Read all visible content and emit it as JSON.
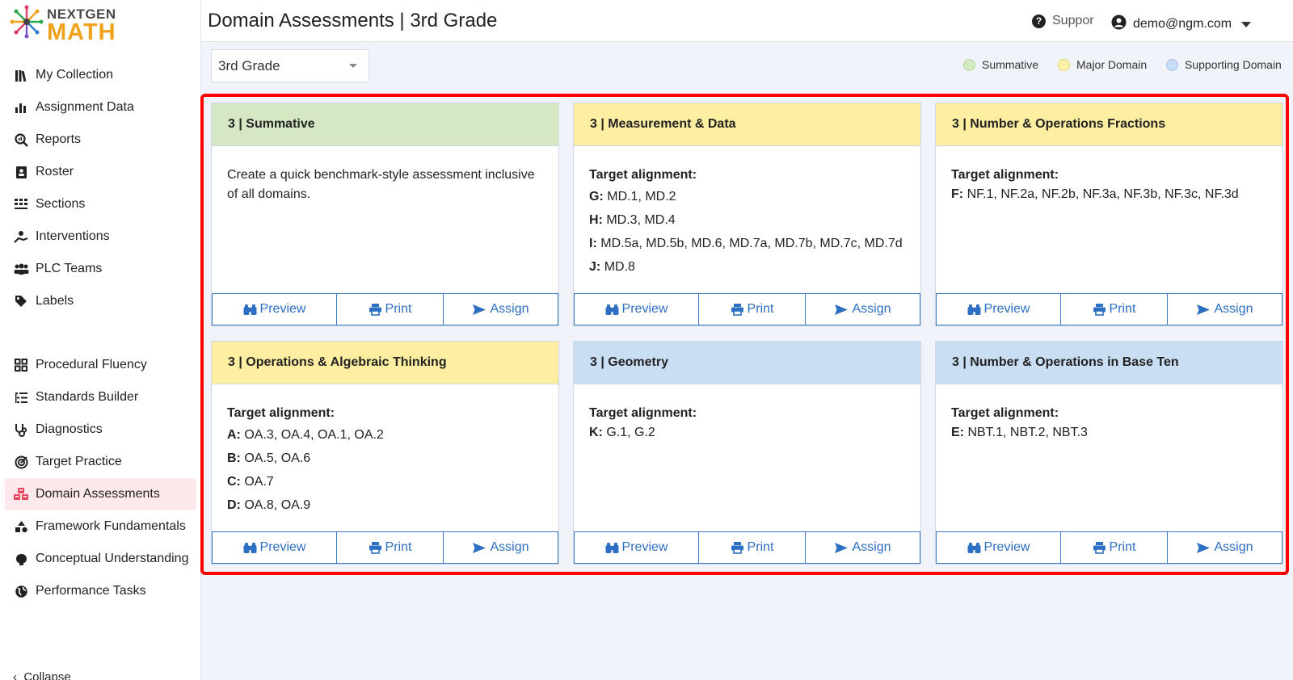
{
  "brand": {
    "top": "NEXTGEN",
    "bottom": "MATH"
  },
  "header": {
    "title": "Domain Assessments | 3rd Grade",
    "support_label": "Suppor",
    "user_email": "demo@ngm.com"
  },
  "sidebar": {
    "group1": [
      {
        "label": "My Collection",
        "icon": "library-icon"
      },
      {
        "label": "Assignment Data",
        "icon": "bar-chart-icon"
      },
      {
        "label": "Reports",
        "icon": "search-chart-icon"
      },
      {
        "label": "Roster",
        "icon": "id-card-icon"
      },
      {
        "label": "Sections",
        "icon": "seating-icon"
      },
      {
        "label": "Interventions",
        "icon": "helping-hand-icon"
      },
      {
        "label": "PLC Teams",
        "icon": "users-icon"
      },
      {
        "label": "Labels",
        "icon": "tag-icon"
      }
    ],
    "group2": [
      {
        "label": "Procedural Fluency",
        "icon": "grid-icon"
      },
      {
        "label": "Standards Builder",
        "icon": "list-check-icon"
      },
      {
        "label": "Diagnostics",
        "icon": "stethoscope-icon"
      },
      {
        "label": "Target Practice",
        "icon": "target-icon"
      },
      {
        "label": "Domain Assessments",
        "icon": "cubes-icon",
        "active": true
      },
      {
        "label": "Framework Fundamentals",
        "icon": "shapes-icon"
      },
      {
        "label": "Conceptual Understanding",
        "icon": "brain-icon"
      },
      {
        "label": "Performance Tasks",
        "icon": "globe-icon"
      }
    ],
    "collapse_label": "Collapse"
  },
  "toolbar": {
    "grade_value": "3rd Grade",
    "legend": [
      {
        "label": "Summative",
        "color": "#d4e8c2"
      },
      {
        "label": "Major Domain",
        "color": "#fdf2a8"
      },
      {
        "label": "Supporting Domain",
        "color": "#c8dcf3"
      }
    ]
  },
  "actions": {
    "preview": "Preview",
    "print": "Print",
    "assign": "Assign"
  },
  "colors": {
    "summative": "#d5e8c3",
    "major": "#fdeea1",
    "supporting": "#c9ddf3",
    "accent": "#2d6fc2",
    "highlight": "#ff0000"
  },
  "cards": [
    {
      "title": "3 | Summative",
      "type": "summative",
      "description": "Create a quick benchmark-style assessment inclusive of all domains."
    },
    {
      "title": "3 | Measurement & Data",
      "type": "major",
      "target_label": "Target alignment:",
      "lines": [
        {
          "key": "G:",
          "val": "MD.1, MD.2"
        },
        {
          "key": "H:",
          "val": "MD.3, MD.4"
        },
        {
          "key": "I:",
          "val": "MD.5a, MD.5b, MD.6, MD.7a, MD.7b, MD.7c, MD.7d"
        },
        {
          "key": "J:",
          "val": "MD.8"
        }
      ]
    },
    {
      "title": "3 | Number & Operations Fractions",
      "type": "major",
      "target_label": "Target alignment:",
      "lines": [
        {
          "key": "F:",
          "val": "NF.1, NF.2a, NF.2b, NF.3a, NF.3b, NF.3c, NF.3d"
        }
      ]
    },
    {
      "title": "3 | Operations & Algebraic Thinking",
      "type": "major",
      "target_label": "Target alignment:",
      "lines": [
        {
          "key": "A:",
          "val": "OA.3, OA.4, OA.1, OA.2"
        },
        {
          "key": "B:",
          "val": "OA.5, OA.6"
        },
        {
          "key": "C:",
          "val": "OA.7"
        },
        {
          "key": "D:",
          "val": "OA.8, OA.9"
        }
      ]
    },
    {
      "title": "3 | Geometry",
      "type": "supporting",
      "target_label": "Target alignment:",
      "lines": [
        {
          "key": "K:",
          "val": "G.1, G.2"
        }
      ]
    },
    {
      "title": "3 | Number & Operations in Base Ten",
      "type": "supporting",
      "target_label": "Target alignment:",
      "lines": [
        {
          "key": "E:",
          "val": "NBT.1, NBT.2, NBT.3"
        }
      ]
    }
  ]
}
